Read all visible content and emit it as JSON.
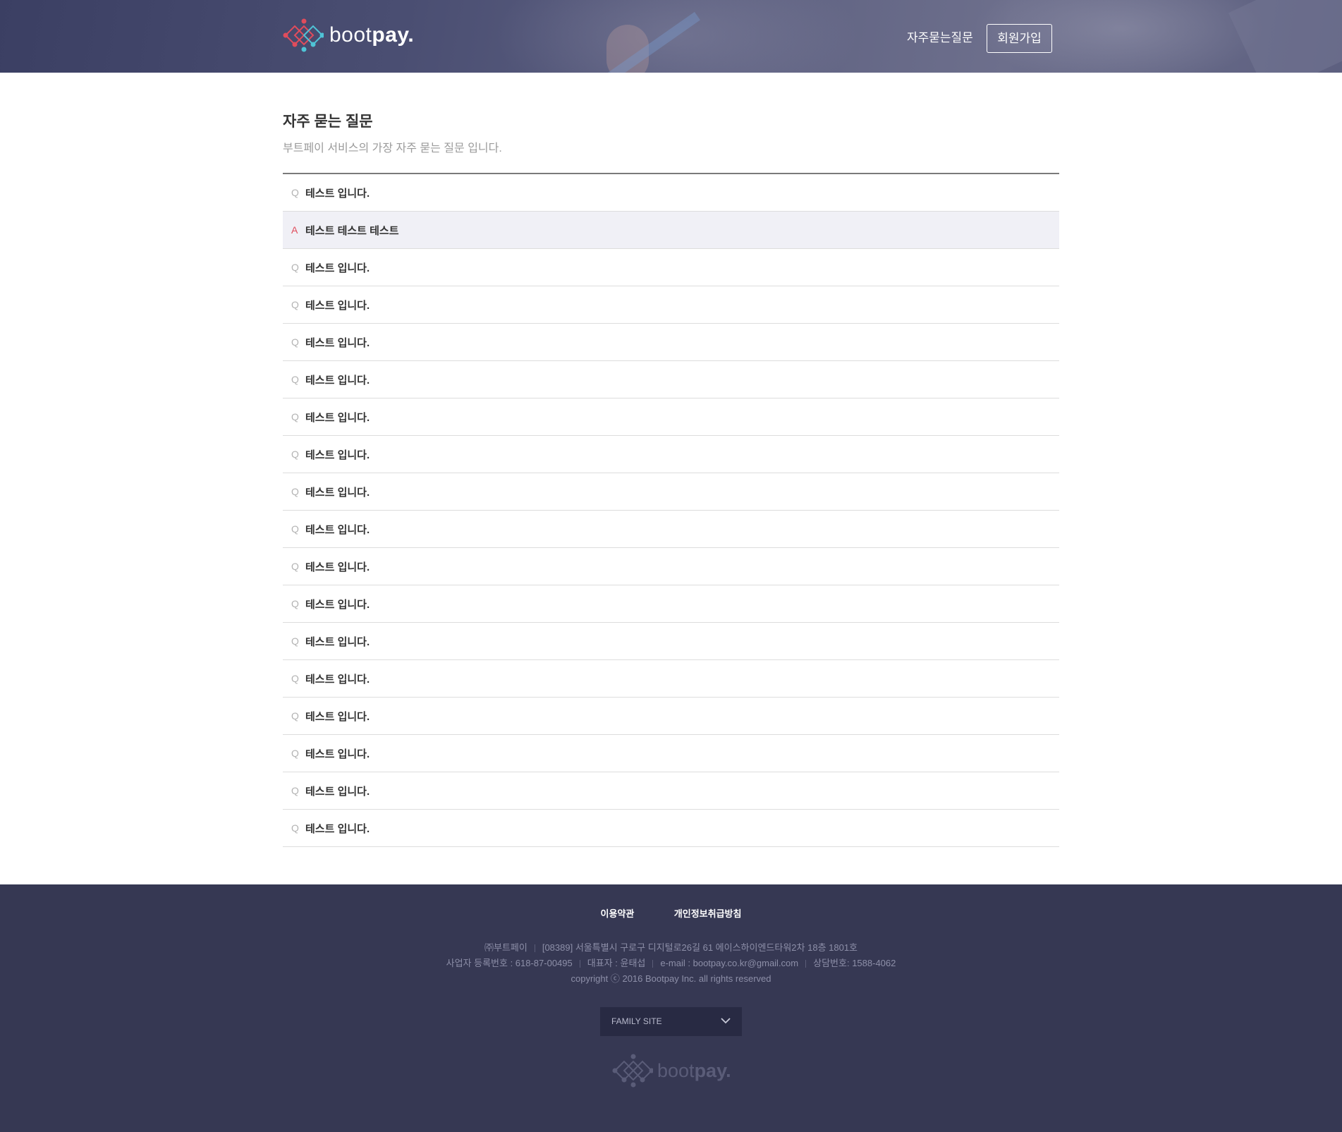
{
  "header": {
    "logo": {
      "text_light": "boot",
      "text_bold": "pay",
      "text_dot": ".",
      "icon": "bootpay-logo-icon"
    },
    "nav_faq": "자주묻는질문",
    "nav_join": "회원가입"
  },
  "main": {
    "title": "자주 묻는 질문",
    "subtitle": "부트페이 서비스의 가장 자주 묻는 질문 입니다.",
    "items": [
      {
        "marker": "Q",
        "text": "테스트 입니다."
      },
      {
        "marker": "A",
        "text": "테스트 테스트 테스트"
      },
      {
        "marker": "Q",
        "text": "테스트 입니다."
      },
      {
        "marker": "Q",
        "text": "테스트 입니다."
      },
      {
        "marker": "Q",
        "text": "테스트 입니다."
      },
      {
        "marker": "Q",
        "text": "테스트 입니다."
      },
      {
        "marker": "Q",
        "text": "테스트 입니다."
      },
      {
        "marker": "Q",
        "text": "테스트 입니다."
      },
      {
        "marker": "Q",
        "text": "테스트 입니다."
      },
      {
        "marker": "Q",
        "text": "테스트 입니다."
      },
      {
        "marker": "Q",
        "text": "테스트 입니다."
      },
      {
        "marker": "Q",
        "text": "테스트 입니다."
      },
      {
        "marker": "Q",
        "text": "테스트 입니다."
      },
      {
        "marker": "Q",
        "text": "테스트 입니다."
      },
      {
        "marker": "Q",
        "text": "테스트 입니다."
      },
      {
        "marker": "Q",
        "text": "테스트 입니다."
      },
      {
        "marker": "Q",
        "text": "테스트 입니다."
      },
      {
        "marker": "Q",
        "text": "테스트 입니다."
      }
    ]
  },
  "footer": {
    "links": [
      "이용약관",
      "개인정보취급방침"
    ],
    "company": "㈜부트페이",
    "address": "[08389] 서울특별시 구로구 디지털로26길 61 에이스하이엔드타워2차 18층 1801호",
    "business_no": "사업자 등록번호 : 618-87-00495",
    "ceo": "대표자 : 윤태섭",
    "email": "e-mail : bootpay.co.kr@gmail.com",
    "phone": "상담번호: 1588-4062",
    "copyright": "copyright ⓒ 2016 Bootpay Inc. all rights reserved",
    "family_site": "FAMILY SITE",
    "logo": {
      "text_light": "boot",
      "text_bold": "pay",
      "text_dot": "."
    }
  },
  "colors": {
    "header_bg": "#4a4e72",
    "footer_bg": "#363853",
    "answer_marker": "#e04c5c",
    "answer_bg": "#f0f0f6"
  }
}
